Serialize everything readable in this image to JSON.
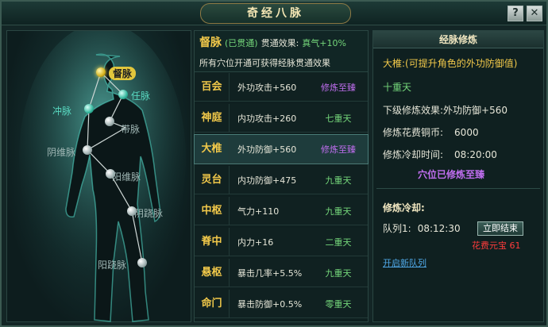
{
  "window": {
    "title": "奇经八脉",
    "help_label": "?",
    "close_label": "✕"
  },
  "body_map": {
    "points": [
      {
        "label": "督脉",
        "state": "active"
      },
      {
        "label": "任脉",
        "state": "teal"
      },
      {
        "label": "冲脉",
        "state": "teal"
      },
      {
        "label": "带脉",
        "state": "normal"
      },
      {
        "label": "阴维脉",
        "state": "normal"
      },
      {
        "label": "阳维脉",
        "state": "normal"
      },
      {
        "label": "阴跷脉",
        "state": "normal"
      },
      {
        "label": "阳跷脉",
        "state": "normal"
      }
    ]
  },
  "meridian": {
    "name": "督脉",
    "status": "(已贯通)",
    "effect_label": "贯通效果:",
    "effect_value": "真气+10%",
    "desc": "所有穴位开通可获得经脉贯通效果"
  },
  "acupoints": [
    {
      "name": "百会",
      "effect": "外功攻击+560",
      "level": "修炼至臻",
      "level_color": "#c06ef0"
    },
    {
      "name": "神庭",
      "effect": "内功攻击+260",
      "level": "七重天",
      "level_color": "#74d67a"
    },
    {
      "name": "大椎",
      "effect": "外功防御+560",
      "level": "修炼至臻",
      "level_color": "#c06ef0"
    },
    {
      "name": "灵台",
      "effect": "内功防御+475",
      "level": "九重天",
      "level_color": "#74d67a"
    },
    {
      "name": "中枢",
      "effect": "气力+110",
      "level": "九重天",
      "level_color": "#74d67a"
    },
    {
      "name": "脊中",
      "effect": "内力+16",
      "level": "二重天",
      "level_color": "#74d67a"
    },
    {
      "name": "悬枢",
      "effect": "暴击几率+5.5%",
      "level": "九重天",
      "level_color": "#74d67a"
    },
    {
      "name": "命门",
      "effect": "暴击防御+0.5%",
      "level": "零重天",
      "level_color": "#74d67a"
    }
  ],
  "detail": {
    "panel_title": "经脉修炼",
    "point_title": "大椎:(可提升角色的外功防御值)",
    "level": "十重天",
    "next_effect_label": "下级修炼效果:",
    "next_effect_value": "外功防御+560",
    "cost_label": "修炼花费铜币:",
    "cost_value": "6000",
    "cooldown_label": "修炼冷却时间:",
    "cooldown_value": "08:20:00",
    "maxed_text": "穴位已修炼至臻",
    "queue_title": "修炼冷却:",
    "queue_label": "队列1:",
    "queue_time": "08:12:30",
    "finish_button": "立即结束",
    "cost_note": "花费元宝 61",
    "open_queue_link": "开启新队列"
  },
  "colors": {
    "accent_gold": "#f2c94a",
    "green": "#74d67a",
    "purple": "#c06ef0",
    "red": "#ff3c3c",
    "link": "#4fa7e6"
  }
}
